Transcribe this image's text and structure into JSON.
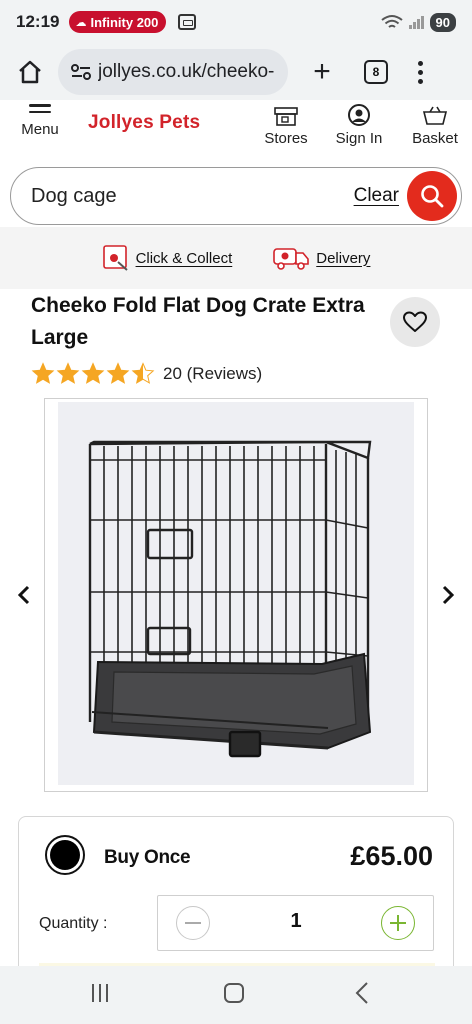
{
  "status_bar": {
    "time": "12:19",
    "carrier_pill": "Infinity 200",
    "battery": "90"
  },
  "browser": {
    "url": "jollyes.co.uk/cheeko-",
    "tab_count": "8"
  },
  "header": {
    "menu_label": "Menu",
    "logo": "Jollyes Pets",
    "stores_label": "Stores",
    "signin_label": "Sign In",
    "basket_label": "Basket"
  },
  "search": {
    "value": "Dog cage",
    "clear_label": "Clear"
  },
  "fulfilment": {
    "click_collect": "Click & Collect",
    "delivery": "Delivery"
  },
  "product": {
    "title": "Cheeko Fold Flat Dog Crate Extra Large",
    "rating": 4.5,
    "reviews": "20 (Reviews)"
  },
  "purchase": {
    "option_label": "Buy Once",
    "price": "£65.00",
    "quantity_label": "Quantity :",
    "quantity": "1"
  },
  "colors": {
    "brand_red": "#d2232a",
    "search_button": "#e32b1d",
    "star": "#f5a623",
    "plus_green": "#7ab632"
  }
}
